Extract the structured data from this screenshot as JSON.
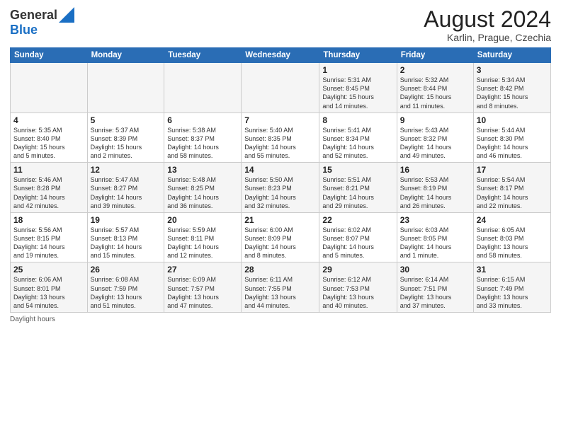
{
  "logo": {
    "general": "General",
    "blue": "Blue"
  },
  "header": {
    "title": "August 2024",
    "subtitle": "Karlin, Prague, Czechia"
  },
  "days_of_week": [
    "Sunday",
    "Monday",
    "Tuesday",
    "Wednesday",
    "Thursday",
    "Friday",
    "Saturday"
  ],
  "weeks": [
    [
      {
        "day": "",
        "info": ""
      },
      {
        "day": "",
        "info": ""
      },
      {
        "day": "",
        "info": ""
      },
      {
        "day": "",
        "info": ""
      },
      {
        "day": "1",
        "info": "Sunrise: 5:31 AM\nSunset: 8:45 PM\nDaylight: 15 hours\nand 14 minutes."
      },
      {
        "day": "2",
        "info": "Sunrise: 5:32 AM\nSunset: 8:44 PM\nDaylight: 15 hours\nand 11 minutes."
      },
      {
        "day": "3",
        "info": "Sunrise: 5:34 AM\nSunset: 8:42 PM\nDaylight: 15 hours\nand 8 minutes."
      }
    ],
    [
      {
        "day": "4",
        "info": "Sunrise: 5:35 AM\nSunset: 8:40 PM\nDaylight: 15 hours\nand 5 minutes."
      },
      {
        "day": "5",
        "info": "Sunrise: 5:37 AM\nSunset: 8:39 PM\nDaylight: 15 hours\nand 2 minutes."
      },
      {
        "day": "6",
        "info": "Sunrise: 5:38 AM\nSunset: 8:37 PM\nDaylight: 14 hours\nand 58 minutes."
      },
      {
        "day": "7",
        "info": "Sunrise: 5:40 AM\nSunset: 8:35 PM\nDaylight: 14 hours\nand 55 minutes."
      },
      {
        "day": "8",
        "info": "Sunrise: 5:41 AM\nSunset: 8:34 PM\nDaylight: 14 hours\nand 52 minutes."
      },
      {
        "day": "9",
        "info": "Sunrise: 5:43 AM\nSunset: 8:32 PM\nDaylight: 14 hours\nand 49 minutes."
      },
      {
        "day": "10",
        "info": "Sunrise: 5:44 AM\nSunset: 8:30 PM\nDaylight: 14 hours\nand 46 minutes."
      }
    ],
    [
      {
        "day": "11",
        "info": "Sunrise: 5:46 AM\nSunset: 8:28 PM\nDaylight: 14 hours\nand 42 minutes."
      },
      {
        "day": "12",
        "info": "Sunrise: 5:47 AM\nSunset: 8:27 PM\nDaylight: 14 hours\nand 39 minutes."
      },
      {
        "day": "13",
        "info": "Sunrise: 5:48 AM\nSunset: 8:25 PM\nDaylight: 14 hours\nand 36 minutes."
      },
      {
        "day": "14",
        "info": "Sunrise: 5:50 AM\nSunset: 8:23 PM\nDaylight: 14 hours\nand 32 minutes."
      },
      {
        "day": "15",
        "info": "Sunrise: 5:51 AM\nSunset: 8:21 PM\nDaylight: 14 hours\nand 29 minutes."
      },
      {
        "day": "16",
        "info": "Sunrise: 5:53 AM\nSunset: 8:19 PM\nDaylight: 14 hours\nand 26 minutes."
      },
      {
        "day": "17",
        "info": "Sunrise: 5:54 AM\nSunset: 8:17 PM\nDaylight: 14 hours\nand 22 minutes."
      }
    ],
    [
      {
        "day": "18",
        "info": "Sunrise: 5:56 AM\nSunset: 8:15 PM\nDaylight: 14 hours\nand 19 minutes."
      },
      {
        "day": "19",
        "info": "Sunrise: 5:57 AM\nSunset: 8:13 PM\nDaylight: 14 hours\nand 15 minutes."
      },
      {
        "day": "20",
        "info": "Sunrise: 5:59 AM\nSunset: 8:11 PM\nDaylight: 14 hours\nand 12 minutes."
      },
      {
        "day": "21",
        "info": "Sunrise: 6:00 AM\nSunset: 8:09 PM\nDaylight: 14 hours\nand 8 minutes."
      },
      {
        "day": "22",
        "info": "Sunrise: 6:02 AM\nSunset: 8:07 PM\nDaylight: 14 hours\nand 5 minutes."
      },
      {
        "day": "23",
        "info": "Sunrise: 6:03 AM\nSunset: 8:05 PM\nDaylight: 14 hours\nand 1 minute."
      },
      {
        "day": "24",
        "info": "Sunrise: 6:05 AM\nSunset: 8:03 PM\nDaylight: 13 hours\nand 58 minutes."
      }
    ],
    [
      {
        "day": "25",
        "info": "Sunrise: 6:06 AM\nSunset: 8:01 PM\nDaylight: 13 hours\nand 54 minutes."
      },
      {
        "day": "26",
        "info": "Sunrise: 6:08 AM\nSunset: 7:59 PM\nDaylight: 13 hours\nand 51 minutes."
      },
      {
        "day": "27",
        "info": "Sunrise: 6:09 AM\nSunset: 7:57 PM\nDaylight: 13 hours\nand 47 minutes."
      },
      {
        "day": "28",
        "info": "Sunrise: 6:11 AM\nSunset: 7:55 PM\nDaylight: 13 hours\nand 44 minutes."
      },
      {
        "day": "29",
        "info": "Sunrise: 6:12 AM\nSunset: 7:53 PM\nDaylight: 13 hours\nand 40 minutes."
      },
      {
        "day": "30",
        "info": "Sunrise: 6:14 AM\nSunset: 7:51 PM\nDaylight: 13 hours\nand 37 minutes."
      },
      {
        "day": "31",
        "info": "Sunrise: 6:15 AM\nSunset: 7:49 PM\nDaylight: 13 hours\nand 33 minutes."
      }
    ]
  ],
  "footer": {
    "note": "Daylight hours"
  }
}
